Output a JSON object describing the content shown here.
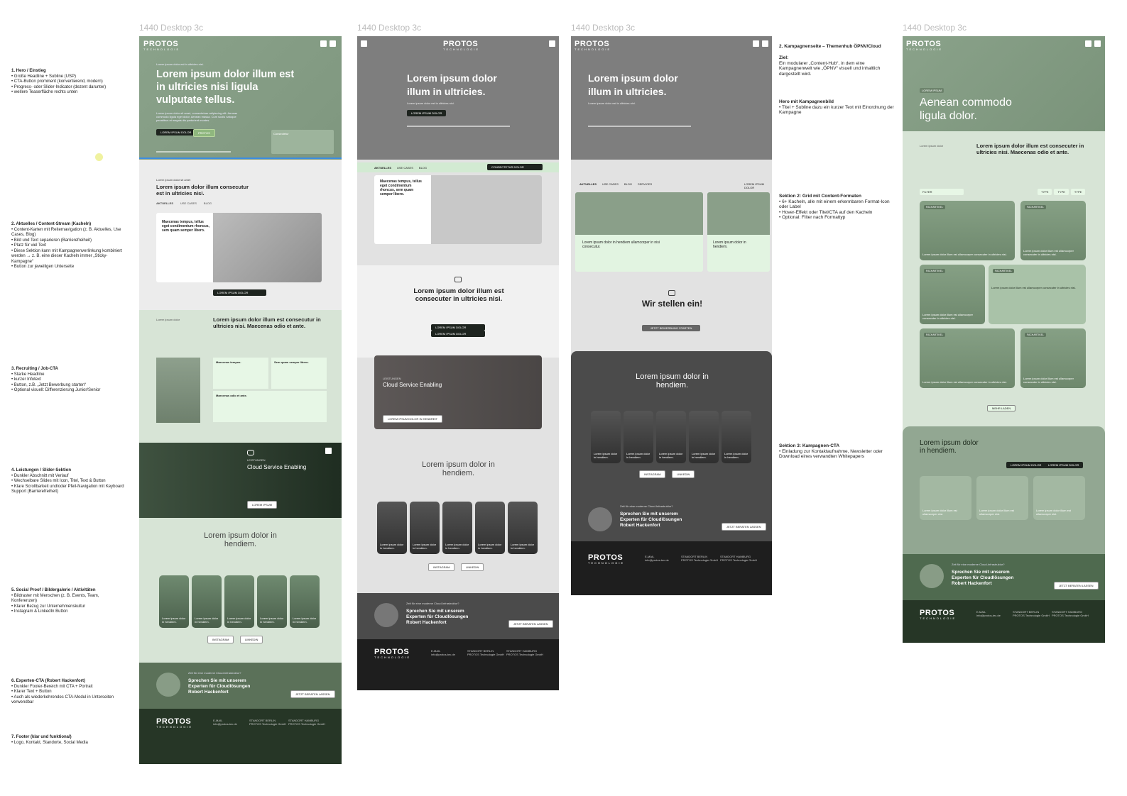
{
  "frame_label": "1440 Desktop 3c",
  "brand": {
    "name": "PROTOS",
    "tagline": "TECHNOLOGIE"
  },
  "left_notes": [
    {
      "title": "1. Hero / Einstieg",
      "items": [
        "Große Headline + Subline (USP)",
        "CTA-Button prominent (konvertierend, modern)",
        "Progress- oder Slider-Indicator (dezent darunter)",
        "weitere Teaserfläche rechts unten"
      ]
    },
    {
      "title": "2. Aktuelles / Content-Stream (Kacheln)",
      "items": [
        "Content-Karten mit Reiternavigation (z. B. Aktuelles, Use Cases, Blog)",
        "Bild und Text separieren (Barrierefreiheit)",
        "Platz für viel Text",
        "Diese Sektion kann mit Kampagnenverlinkung kombiniert werden → z. B. eine dieser Kacheln immer „Sticky-Kampagne“",
        "Button zur jeweiligen Unterseite"
      ]
    },
    {
      "title": "3. Recruiting / Job-CTA",
      "items": [
        "Starke Headline",
        "kurzer Infotext",
        "Button, z.B. „Jetzt Bewerbung starten“",
        "Optional visuell: Differenzierung Junior/Senior"
      ]
    },
    {
      "title": "4. Leistungen / Slider-Sektion",
      "items": [
        "Dunkler Abschnitt mit Verlauf",
        "Wechselbare Slides mit Icon, Titel, Text & Button",
        "Klare Scrollbarkeit und/oder Pfeil-Navigation mit Keyboard Support (Barrierefreiheit)"
      ]
    },
    {
      "title": "5. Social Proof / Bildergalerie / Aktivitäten",
      "items": [
        "Bildraster mit Menschen (z. B. Events, Team, Konferenzen)",
        "Klarer Bezug zur Unternehmenskultur",
        "Instagram & LinkedIn Button"
      ]
    },
    {
      "title": "6. Experten-CTA (Robert Hackenfort)",
      "items": [
        "Dunkler Footer-Bereich mit CTA + Portrait",
        "Klarer Text + Button",
        "Auch als wiederkehrendes CTA-Modul in Unterseiten verwendbar"
      ]
    },
    {
      "title": "7. Footer (klar und funktional)",
      "items": [
        "Logo, Kontakt, Standorte, Social Media"
      ]
    }
  ],
  "right_notes": [
    {
      "title": "2. Kampagnenseite – Themenhub ÖPNV/Cloud",
      "items": []
    },
    {
      "title": "Ziel:",
      "text": "Ein modularer „Content-Hub“, in dem eine Kampagnenwelt wie „ÖPNV“ visuell und inhaltlich dargestellt wird.",
      "items": []
    },
    {
      "title": "Hero mit Kampagnenbild",
      "items": [
        "Titel + Subline dazu ein kurzer Text mit Einordnung der Kampagne"
      ]
    },
    {
      "title": "Sektion 2: Grid mit Content-Formaten",
      "items": [
        "6+ Kacheln, alle mit einem erkennbaren Format-Icon oder Label",
        "Hover-Effekt oder Titel/CTA auf den Kacheln",
        "Optional: Filter nach Formattyp"
      ]
    },
    {
      "title": "Sektion 3: Kampagnen-CTA",
      "items": [
        "Einladung zur Kontaktaufnahme, Newsletter oder Download eines verwandten Whitepapers"
      ]
    }
  ],
  "f1": {
    "kicker": "Lorem ipsum dolor est in ultricies nisi.",
    "headline": "Lorem ipsum dolor illum est in ultricies nisi ligula vulputate tellus.",
    "body": "Lorem ipsum dolor sit amet, consectetuer adipiscing elit. Aenean commodo ligula eget dolor. Aenean massa. Cum sociis natoque penatibus et magnis dis parturient montes.",
    "cta1": "LOREM IPSUM DOLOR",
    "cta2": "PROTOS",
    "teaser_title": "Consectetur",
    "s2_kicker": "Lorem ipsum dolor sit amet",
    "s2_head": "Lorem ipsum dolor illum consecutur est in ultricies nisi.",
    "tabs": [
      "AKTUELLES",
      "USE CASES",
      "BLOG"
    ],
    "card_head": "Maecenas tempus, tellus eget condimentum rhoncus, sem quam semper libero.",
    "s2_btn": "LOREM IPSUM DOLOR",
    "s3_kicker": "Lorem ipsum dolor",
    "s3_head": "Lorem ipsum dolor illum est consecutur in ultricies nisi. Maecenas odio et ante.",
    "s3_boxes": [
      "Maecenas tempus.",
      "Sem quam semper libero.",
      "Maecenas odio et ante."
    ],
    "s4_kicker": "LEISTUNGEN",
    "s4_head": "Cloud Service Enabling",
    "s4_btn": "LOREM IPSUM",
    "s5_head": "Lorem ipsum dolor in hendiem.",
    "tile_text": "Lorem ipsum dolor in hendiem.",
    "insta": "INSTAGRAM",
    "linkedin": "LINKEDIN",
    "cta_kicker": "Zeit für eine moderne Cloud-Infrastruktur?",
    "cta_head": "Sprechen Sie mit unserem Experten für Cloudlösungen Robert Hackenfort",
    "cta_btn": "JETZT BERATEN LASSEN"
  },
  "f2": {
    "headline": "Lorem ipsum dolor illum in ultricies.",
    "sub": "Lorem ipsum dolor est in ultricies nisi.",
    "btn": "LOREM IPSUM DOLOR",
    "tabs": [
      "AKTUELLES",
      "USE CASES",
      "BLOG"
    ],
    "bar_btn": "CONSECTETUR DOLOR",
    "card_head": "Maecenas tempus, tellus eget condimentum rhoncus, sem quam semper libero.",
    "s3_head": "Lorem ipsum dolor illum est consecuter in ultricies nisi.",
    "s3_btn1": "LOREM IPSUM DOLOR",
    "s3_btn2": "LOREM IPSUM DOLOR",
    "s4_kicker": "LEISTUNGEN",
    "s4_head": "Cloud Service Enabling",
    "s4_btn": "LOREM IPSUM DOLOR IN HENDREIT",
    "s5_head": "Lorem ipsum dolor in hendiem.",
    "tile_text": "Lorem ipsum dolor in hendiem.",
    "insta": "INSTAGRAM",
    "linkedin": "LINKEDIN",
    "cta_kicker": "Zeit für eine moderne Cloud-Infrastruktur?",
    "cta_head": "Sprechen Sie mit unserem Experten für Cloudlösungen Robert Hackenfort",
    "cta_btn": "JETZT BERATEN LASSEN"
  },
  "f3": {
    "headline": "Lorem ipsum dolor illum in ultricies.",
    "sub": "Lorem ipsum dolor est in ultricies nisi.",
    "tabs": [
      "AKTUELLES",
      "USE CASES",
      "BLOG",
      "SERVICES"
    ],
    "tab_right": "LOREM IPSUM DOLOR",
    "card1": "Lorem ipsum dolor in hendiem ullamcorper in nisi consecutur.",
    "card2": "Lorem ipsum dolor in hendiem.",
    "s3_head": "Wir stellen ein!",
    "s3_btn": "JETZT BEWERBUNG STARTEN",
    "s4_head": "Lorem ipsum dolor in hendiem.",
    "tile_text": "Lorem ipsum dolor in hendiem.",
    "insta": "INSTAGRAM",
    "linkedin": "LINKEDIN",
    "cta_kicker": "Zeit für eine moderne Cloud-Infrastruktur?",
    "cta_head": "Sprechen Sie mit unserem Experten für Cloudlösungen Robert Hackenfort",
    "cta_btn": "JETZT BERATEN LASSEN"
  },
  "f4": {
    "kicker": "LOREM IPSUM",
    "headline": "Aenean commodo ligula dolor.",
    "intro_kicker": "Lorem ipsum dolor",
    "intro_head": "Lorem ipsum dolor illum est consecuter in ultricies nisi. Maecenas odio et ante.",
    "filter": "FILTER",
    "chips": [
      "TYPE",
      "TYPE",
      "TYPE"
    ],
    "tile_label": "FACHARTIKEL",
    "tile_text": "Lorem ipsum dolor illum est ullamcorper consecuter in ultricies nisi.",
    "more": "MEHR LADEN",
    "s3_head": "Lorem ipsum dolor in hendiem.",
    "s3_btn1": "LOREM IPSUM DOLOR",
    "s3_btn2": "LOREM IPSUM DOLOR",
    "s3_tile": "Lorem ipsum dolor illum est ullamcorper nisi.",
    "cta_kicker": "Zeit für eine moderne Cloud-Infrastruktur?",
    "cta_head": "Sprechen Sie mit unserem Experten für Cloudlösungen Robert Hackenfort",
    "cta_btn": "JETZT BERATEN LASSEN"
  },
  "footer": {
    "col1_title": "E-MAIL",
    "col1_text": "info@protos-tec.de",
    "col2_title": "STANDORT BERLIN",
    "col2_text": "PROTOS Technologie GmbH",
    "col3_title": "STANDORT HAMBURG",
    "col3_text": "PROTOS Technologie GmbH"
  }
}
